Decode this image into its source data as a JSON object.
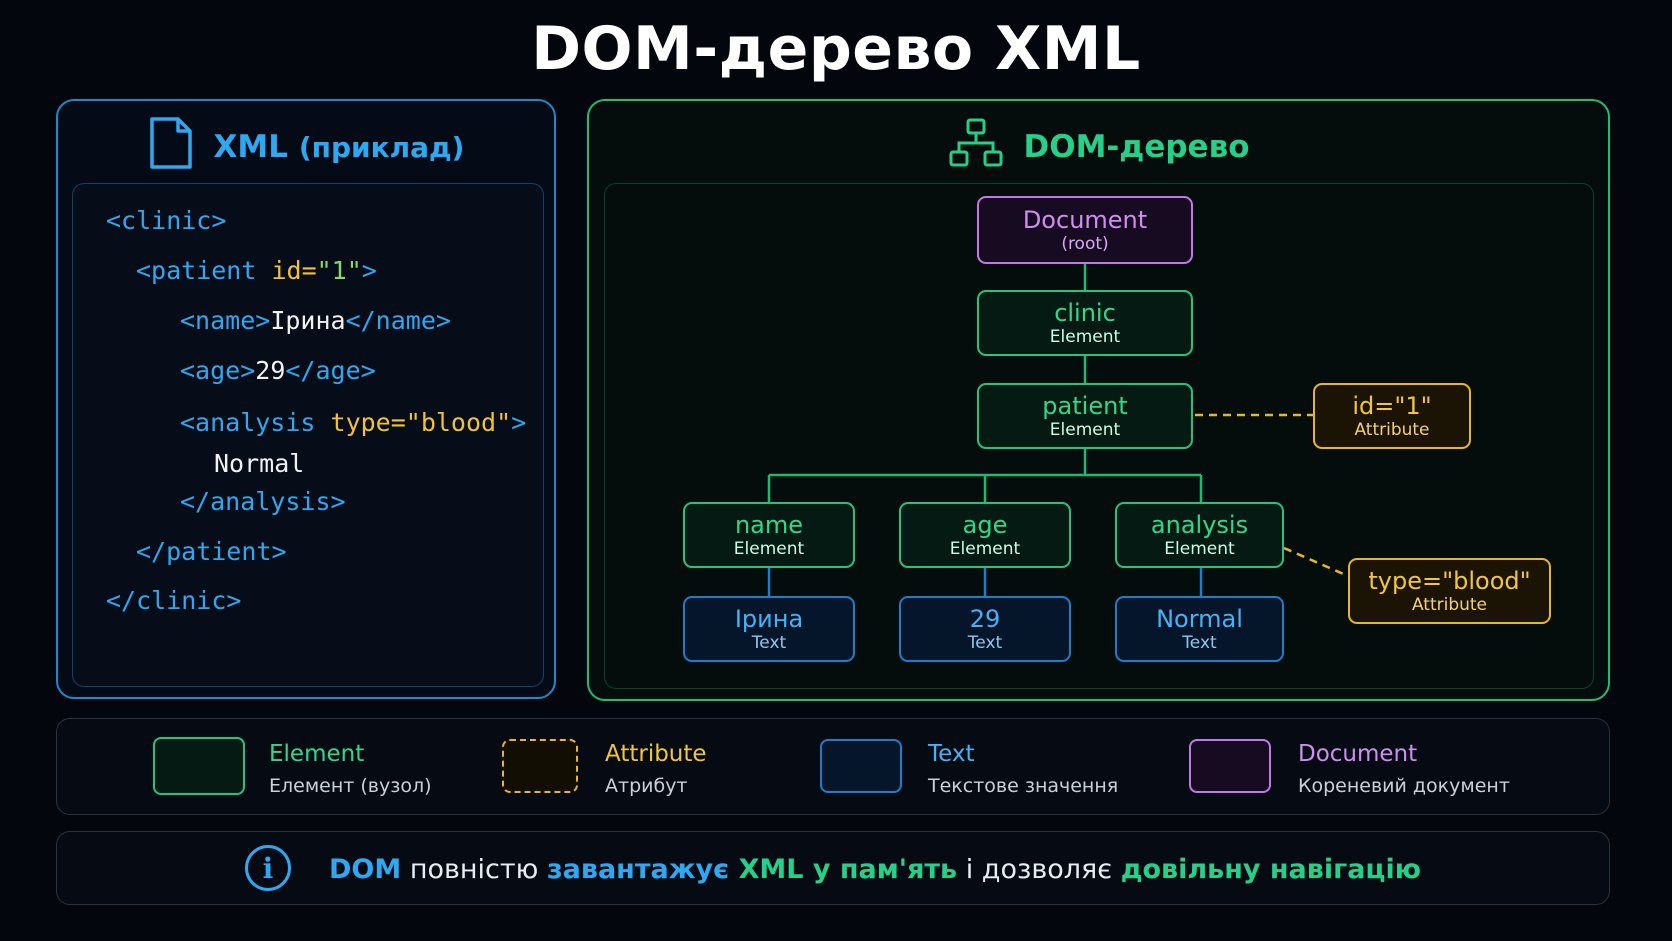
{
  "title": "DOM-дерево XML",
  "xml_panel": {
    "heading": "XML",
    "heading_suffix": "(приклад)",
    "icon": "document-icon",
    "code": {
      "l1": "<clinic>",
      "l2_tag": "<patient ",
      "l2_attr": "id=",
      "l2_val": "\"1\"",
      "l2_end": ">",
      "l3_open": "<name>",
      "l3_text": "Ірина",
      "l3_close": "</name>",
      "l4_open": "<age>",
      "l4_text": "29",
      "l4_close": "</age>",
      "l5_tag": "<analysis ",
      "l5_attr": "type=",
      "l5_val": "\"blood\"",
      "l5_end": ">",
      "l6_text": "Normal",
      "l7": "</analysis>",
      "l8": "</patient>",
      "l9": "</clinic>"
    }
  },
  "dom_panel": {
    "heading": "DOM-дерево",
    "icon": "hierarchy-icon",
    "nodes": {
      "document": {
        "label": "Document",
        "sub": "(root)"
      },
      "clinic": {
        "label": "clinic",
        "sub": "Element"
      },
      "patient": {
        "label": "patient",
        "sub": "Element"
      },
      "id_attr": {
        "label": "id=\"1\"",
        "sub": "Attribute"
      },
      "name": {
        "label": "name",
        "sub": "Element"
      },
      "age": {
        "label": "age",
        "sub": "Element"
      },
      "analysis": {
        "label": "analysis",
        "sub": "Element"
      },
      "type_attr": {
        "label": "type=\"blood\"",
        "sub": "Attribute"
      },
      "irina": {
        "label": "Ірина",
        "sub": "Text"
      },
      "n29": {
        "label": "29",
        "sub": "Text"
      },
      "normal": {
        "label": "Normal",
        "sub": "Text"
      }
    }
  },
  "legend": {
    "element": {
      "label": "Element",
      "desc": "Елемент (вузол)"
    },
    "attribute": {
      "label": "Attribute",
      "desc": "Атрибут"
    },
    "text": {
      "label": "Text",
      "desc": "Текстове значення"
    },
    "document": {
      "label": "Document",
      "desc": "Кореневий документ"
    }
  },
  "info": {
    "icon": "info-icon",
    "p1": "DOM",
    "p2": " повністю ",
    "p3": "завантажує",
    "p4": " XML у пам'ять",
    "p5": " і дозволяє ",
    "p6": "довільну навігацію"
  },
  "colors": {
    "element": "#23c47f",
    "attribute": "#e7b81f",
    "text": "#1e7fc8",
    "document": "#c179e8"
  }
}
